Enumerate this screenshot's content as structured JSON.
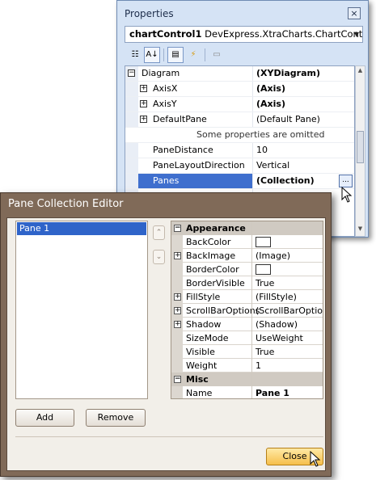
{
  "properties_window": {
    "title": "Properties",
    "close_glyph": "×",
    "object_selector": {
      "name": "chartControl1",
      "type": "DevExpress.XtraCharts.ChartControl",
      "caret": "▼"
    },
    "toolbar": {
      "icons": [
        "categorized-icon",
        "alphabetical-icon",
        "properties-icon",
        "events-icon",
        "property-pages-icon"
      ],
      "glyphs": {
        "categorized": "☷",
        "alphabetical": "A↓",
        "properties": "▤",
        "events": "⚡",
        "pages": "▭"
      }
    },
    "rows": [
      {
        "name": "Diagram",
        "value": "(XYDiagram)",
        "bold": true,
        "expander": "−",
        "level": 0
      },
      {
        "name": "AxisX",
        "value": "(Axis)",
        "bold": true,
        "expander": "+",
        "level": 1
      },
      {
        "name": "AxisY",
        "value": "(Axis)",
        "bold": true,
        "expander": "+",
        "level": 1
      },
      {
        "name": "DefaultPane",
        "value": "(Default Pane)",
        "bold": false,
        "expander": "+",
        "level": 1
      },
      {
        "note": "Some properties are omitted"
      },
      {
        "name": "PaneDistance",
        "value": "10",
        "bold": false,
        "level": 1
      },
      {
        "name": "PaneLayoutDirection",
        "value": "Vertical",
        "bold": false,
        "level": 1
      },
      {
        "name": "Panes",
        "value": "(Collection)",
        "bold": true,
        "level": 1,
        "selected": true,
        "ellipsis": "..."
      }
    ],
    "scroll": {
      "up": "▲",
      "down": "▼"
    }
  },
  "editor": {
    "title": "Pane Collection Editor",
    "list_items": [
      "Pane 1"
    ],
    "move_up_glyph": "⌃",
    "move_down_glyph": "⌄",
    "categories": [
      {
        "name": "Appearance",
        "expander": "−",
        "props": [
          {
            "name": "BackColor",
            "value": "",
            "swatch": "#ffffff"
          },
          {
            "name": "BackImage",
            "value": "(Image)",
            "expander": "+"
          },
          {
            "name": "BorderColor",
            "value": "",
            "swatch": "#ffffff"
          },
          {
            "name": "BorderVisible",
            "value": "True"
          },
          {
            "name": "FillStyle",
            "value": "(FillStyle)",
            "expander": "+"
          },
          {
            "name": "ScrollBarOptions",
            "value": "(ScrollBarOptions)",
            "expander": "+"
          },
          {
            "name": "Shadow",
            "value": "(Shadow)",
            "expander": "+"
          },
          {
            "name": "SizeMode",
            "value": "UseWeight"
          },
          {
            "name": "Visible",
            "value": "True"
          },
          {
            "name": "Weight",
            "value": "1"
          }
        ]
      },
      {
        "name": "Misc",
        "expander": "−",
        "props": [
          {
            "name": "Name",
            "value": "Pane 1",
            "bold": true
          }
        ]
      }
    ],
    "buttons": {
      "add": "Add",
      "remove": "Remove",
      "close": "Close"
    }
  },
  "colors": {
    "selection": "#2f64c9",
    "dialog_frame": "#806a58",
    "close_button": "#f6bf4b"
  }
}
